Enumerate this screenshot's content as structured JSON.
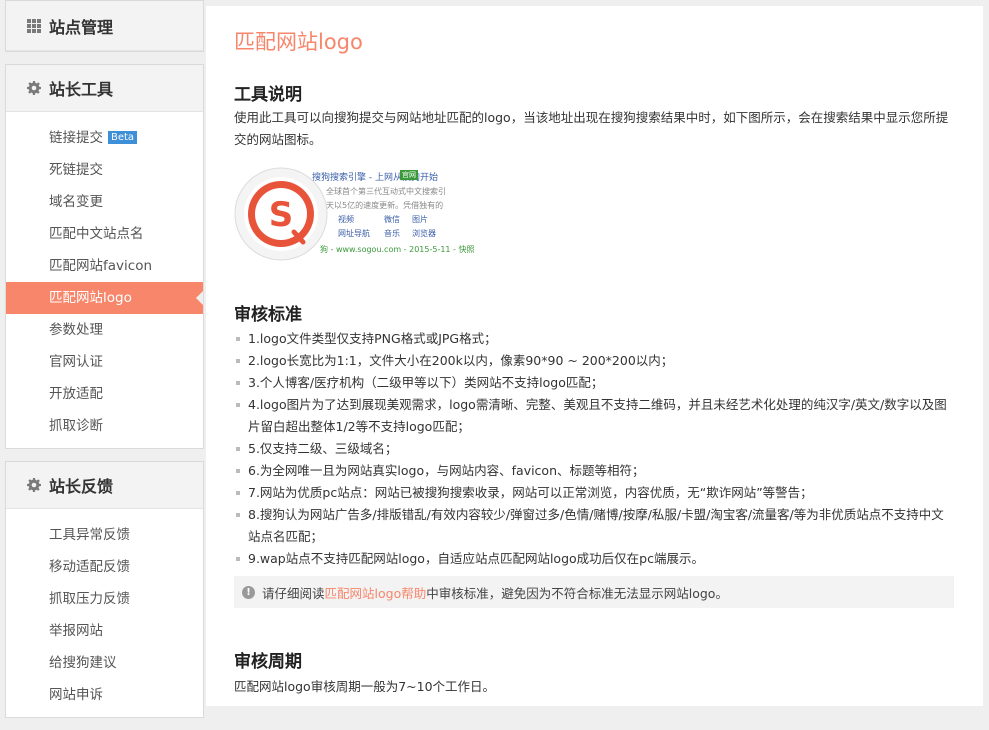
{
  "sidebar": {
    "site_mgmt": {
      "label": "站点管理"
    },
    "tools": {
      "label": "站长工具",
      "items": [
        {
          "label": "链接提交",
          "badge": "Beta"
        },
        {
          "label": "死链提交"
        },
        {
          "label": "域名变更"
        },
        {
          "label": "匹配中文站点名"
        },
        {
          "label": "匹配网站favicon"
        },
        {
          "label": "匹配网站logo",
          "active": true
        },
        {
          "label": "参数处理"
        },
        {
          "label": "官网认证"
        },
        {
          "label": "开放适配"
        },
        {
          "label": "抓取诊断"
        }
      ]
    },
    "feedback": {
      "label": "站长反馈",
      "items": [
        {
          "label": "工具异常反馈"
        },
        {
          "label": "移动适配反馈"
        },
        {
          "label": "抓取压力反馈"
        },
        {
          "label": "举报网站"
        },
        {
          "label": "给搜狗建议"
        },
        {
          "label": "网站申诉"
        }
      ]
    }
  },
  "main": {
    "title": "匹配网站logo",
    "tool_desc": {
      "heading": "工具说明",
      "text": "使用此工具可以向搜狗提交与网站地址匹配的logo，当该地址出现在搜狗搜索结果中时，如下图所示，会在搜索结果中显示您所提交的网站图标。"
    },
    "example": {
      "title": "搜狗搜索引擎 - 上网从搜狗开始",
      "tag": "官网",
      "line1": "全球首个第三代互动式中文搜索引",
      "line2": "天以5亿的速度更新。凭借独有的",
      "links": [
        "视频",
        "微信",
        "图片",
        "网址导航",
        "音乐",
        "浏览器"
      ],
      "url": "狗 - www.sogou.com - 2015-5-11 - 快照"
    },
    "review": {
      "heading": "审核标准",
      "rules": [
        "1.logo文件类型仅支持PNG格式或JPG格式；",
        "2.logo长宽比为1:1，文件大小在200k以内，像素90*90 ~ 200*200以内；",
        "3.个人博客/医疗机构（二级甲等以下）类网站不支持logo匹配；",
        "4.logo图片为了达到展现美观需求，logo需清晰、完整、美观且不支持二维码，并且未经艺术化处理的纯汉字/英文/数字以及图片留白超出整体1/2等不支持logo匹配；",
        "5.仅支持二级、三级域名；",
        "6.为全网唯一且为网站真实logo，与网站内容、favicon、标题等相符；",
        "7.网站为优质pc站点：网站已被搜狗搜索收录，网站可以正常浏览，内容优质，无“欺诈网站”等警告；",
        "8.搜狗认为网站广告多/排版错乱/有效内容较少/弹窗过多/色情/赌博/按摩/私服/卡盟/淘宝客/流量客/等为非优质站点不支持中文站点名匹配；",
        "9.wap站点不支持匹配网站logo，自适应站点匹配网站logo成功后仅在pc端展示。"
      ],
      "notice_before": "请仔细阅读",
      "notice_link": "匹配网站logo帮助",
      "notice_after": "中审核标准，避免因为不符合标准无法显示网站logo。"
    },
    "period": {
      "heading": "审核周期",
      "text": "匹配网站logo审核周期一般为7~10个工作日。"
    }
  },
  "colors": {
    "accent": "#f7866b",
    "beta": "#3d8fd8",
    "sogou_red": "#e8543a"
  }
}
